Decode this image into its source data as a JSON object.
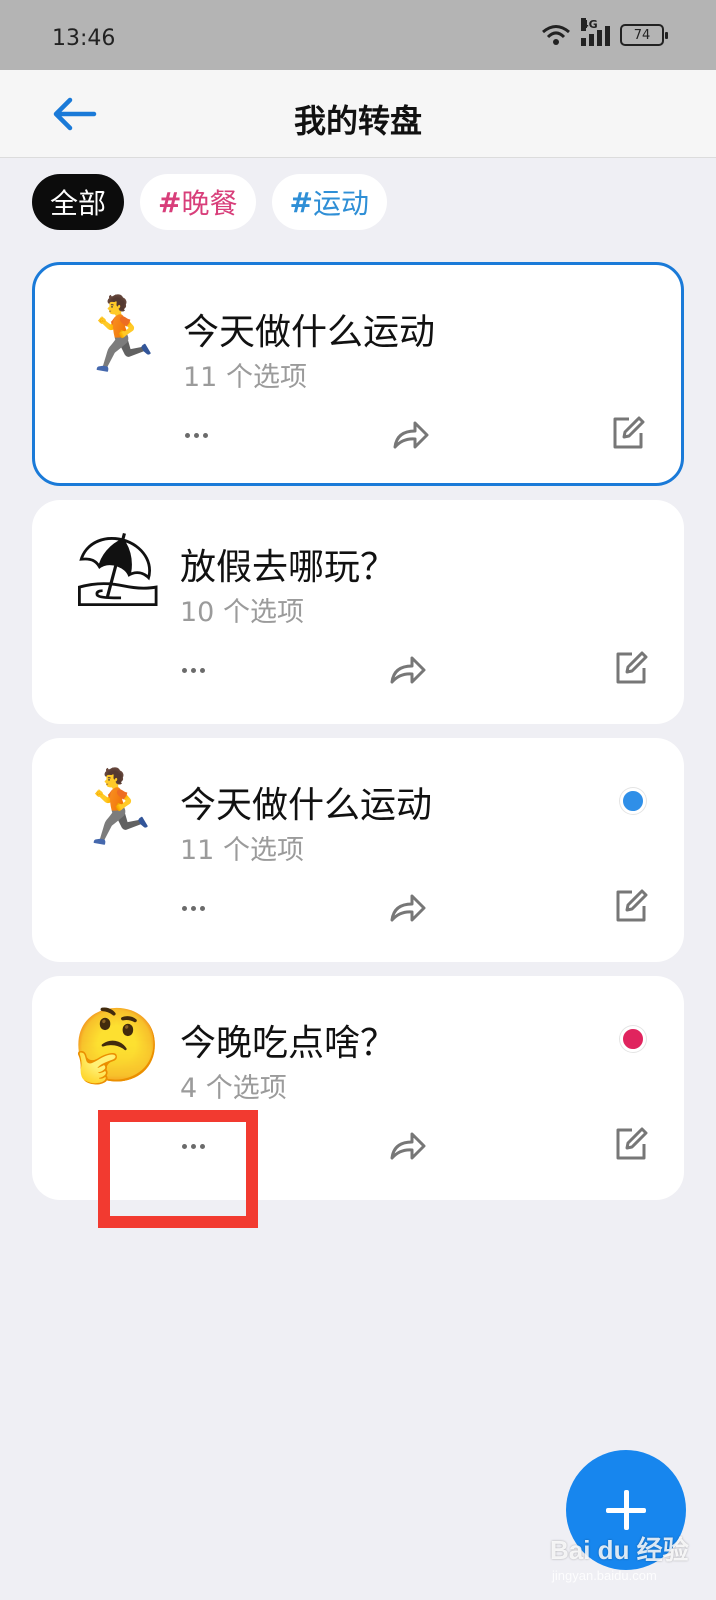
{
  "status_bar": {
    "time": "13:46",
    "network": "4G",
    "battery": "74"
  },
  "header": {
    "title": "我的转盘"
  },
  "tags": [
    {
      "label": "全部",
      "active": true
    },
    {
      "hash": "#",
      "label": "晚餐",
      "color": "#d83e7a"
    },
    {
      "hash": "#",
      "label": "运动",
      "color": "#2f8fd6"
    }
  ],
  "cards": [
    {
      "emoji": "🏃",
      "emoji_name": "person-running-icon",
      "title": "今天做什么运动",
      "subtitle": "11 个选项",
      "selected": true
    },
    {
      "emoji": "⛱",
      "emoji_name": "beach-umbrella-icon",
      "title": "放假去哪玩？",
      "subtitle": "10 个选项"
    },
    {
      "emoji": "🏃",
      "emoji_name": "person-running-icon",
      "title": "今天做什么运动",
      "subtitle": "11 个选项",
      "dot_color": "#2f8fe8"
    },
    {
      "emoji": "🤔",
      "emoji_name": "thinking-face-icon",
      "title": "今晚吃点啥？",
      "subtitle": "4 个选项",
      "dot_color": "#e0245e"
    }
  ],
  "watermark": {
    "text": "Bai du 经验",
    "url": "jingyan.baidu.com"
  },
  "colors": {
    "accent": "#1786ee",
    "highlight": "#f23a30"
  }
}
